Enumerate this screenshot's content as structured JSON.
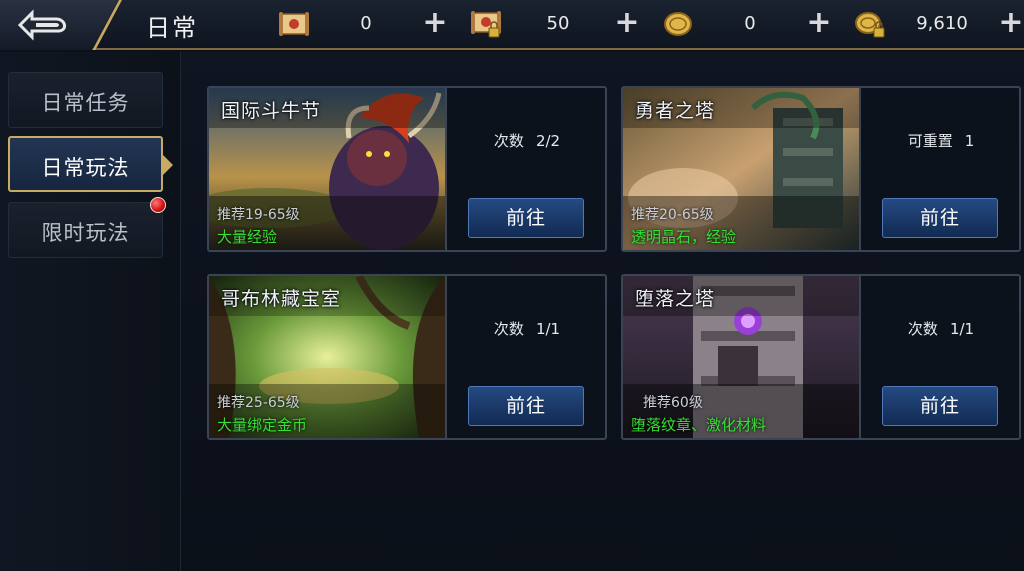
{
  "header": {
    "title": "日常",
    "currencies": [
      {
        "icon": "scroll-icon",
        "value": "0"
      },
      {
        "icon": "locked-scroll-icon",
        "value": "50"
      },
      {
        "icon": "gold-coin-icon",
        "value": "0"
      },
      {
        "icon": "locked-coin-icon",
        "value": "9,610"
      }
    ],
    "plus": "+"
  },
  "sidebar": {
    "tabs": [
      {
        "label": "日常任务",
        "active": false,
        "notify": false
      },
      {
        "label": "日常玩法",
        "active": true,
        "notify": false
      },
      {
        "label": "限时玩法",
        "active": false,
        "notify": true
      }
    ]
  },
  "cards": [
    {
      "name": "国际斗牛节",
      "recommend": "推荐19-65级",
      "reward": "大量经验",
      "count_label": "次数",
      "count_value": "2/2",
      "button": "前往"
    },
    {
      "name": "勇者之塔",
      "recommend": "推荐20-65级",
      "reward": "透明晶石，经验",
      "count_label": "可重置",
      "count_value": "1",
      "button": "前往"
    },
    {
      "name": "哥布林藏宝室",
      "recommend": "推荐25-65级",
      "reward": "大量绑定金币",
      "count_label": "次数",
      "count_value": "1/1",
      "button": "前往"
    },
    {
      "name": "堕落之塔",
      "recommend": "推荐60级",
      "reward": "堕落纹章、激化材料",
      "count_label": "次数",
      "count_value": "1/1",
      "button": "前往"
    }
  ],
  "colors": {
    "accent_gold": "#c7aa63",
    "reward_green": "#33e033",
    "button_blue": "#254a82",
    "notify_red": "#d10f0f"
  }
}
